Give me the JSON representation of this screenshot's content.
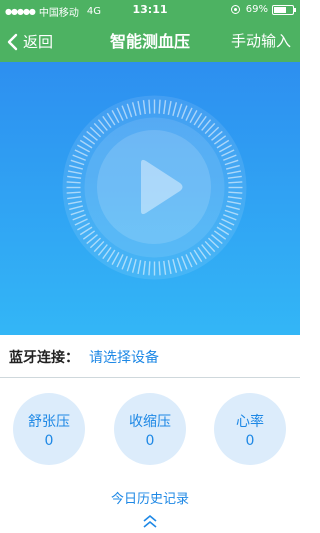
{
  "status_bar": {
    "signal": "●●●●●",
    "carrier": "中国移动",
    "network": "4G",
    "time": "13:11",
    "battery_text": "69%",
    "battery_level": 0.69
  },
  "nav": {
    "back_label": "返回",
    "title": "智能测血压",
    "manual_label": "手动输入"
  },
  "bluetooth": {
    "label": "蓝牙连接：",
    "value": "请选择设备"
  },
  "readings": [
    {
      "label": "舒张压",
      "value": "0"
    },
    {
      "label": "收缩压",
      "value": "0"
    },
    {
      "label": "心率",
      "value": "0"
    }
  ],
  "history": {
    "label": "今日历史记录"
  },
  "colors": {
    "header": "#4db262",
    "accent": "#1e88e5",
    "reading_bg": "#dcecfb"
  },
  "icons": [
    "signal-icon",
    "lock-rotation-icon",
    "battery-icon",
    "chevron-left-icon",
    "play-icon",
    "double-chevron-up-icon"
  ]
}
